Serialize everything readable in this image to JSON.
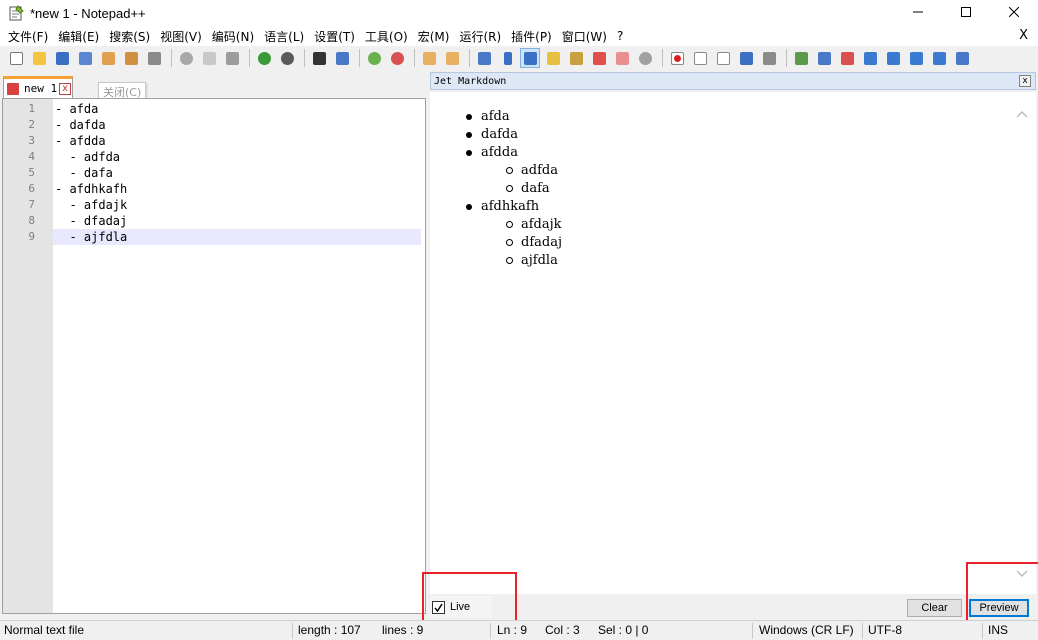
{
  "window": {
    "title": "*new 1 - Notepad++"
  },
  "menu": {
    "items": [
      "文件(F)",
      "编辑(E)",
      "搜索(S)",
      "视图(V)",
      "编码(N)",
      "语言(L)",
      "设置(T)",
      "工具(O)",
      "宏(M)",
      "运行(R)",
      "插件(P)",
      "窗口(W)",
      "?"
    ],
    "close": "X"
  },
  "toolbar": {
    "icons": [
      "new-file-icon",
      "open-file-icon",
      "save-icon",
      "save-all-icon",
      "close-file-icon",
      "close-all-icon",
      "print-icon",
      "cut-icon",
      "copy-icon",
      "paste-icon",
      "undo-icon",
      "redo-icon",
      "find-icon",
      "replace-icon",
      "zoom-in-icon",
      "zoom-out-icon",
      "sync-vertical-icon",
      "sync-horizontal-icon",
      "word-wrap-icon",
      "show-all-chars-icon",
      "indent-guide-icon",
      "lang-define-icon",
      "doc-map-icon",
      "function-list-icon",
      "folder-workspace-icon",
      "monitor-icon",
      "record-macro-icon",
      "stop-record-icon",
      "play-macro-icon",
      "run-macro-multiple-icon",
      "save-macro-icon",
      "jet-md-preview-icon",
      "jet-md-table-icon",
      "jet-md-html-icon",
      "jet-md-top-icon",
      "jet-md-up-icon",
      "jet-md-down-icon",
      "jet-md-bottom-icon",
      "jet-md-config-icon"
    ]
  },
  "tab": {
    "label": "new 1",
    "close": "x",
    "tooltip": "关闭(C)"
  },
  "editor": {
    "line_numbers": [
      "1",
      "2",
      "3",
      "4",
      "5",
      "6",
      "7",
      "8",
      "9"
    ],
    "lines": [
      "- afda",
      "- dafda",
      "- afdda",
      "  - adfda",
      "  - dafa",
      "- afdhkafh",
      "  - afdajk",
      "  - dfadaj",
      "  - ajfdla"
    ],
    "current_line": 9
  },
  "panel": {
    "title": "Jet Markdown",
    "close": "x",
    "list": [
      {
        "text": "afda",
        "children": []
      },
      {
        "text": "dafda",
        "children": []
      },
      {
        "text": "afdda",
        "children": [
          "adfda",
          "dafa"
        ]
      },
      {
        "text": "afdhkafh",
        "children": [
          "afdajk",
          "dfadaj",
          "ajfdla"
        ]
      }
    ],
    "live_label": "Live",
    "live_checked": true,
    "clear_label": "Clear",
    "preview_label": "Preview"
  },
  "status": {
    "file_type": "Normal text file",
    "length": "length : 107",
    "lines": "lines : 9",
    "ln": "Ln : 9",
    "col": "Col : 3",
    "sel": "Sel : 0 | 0",
    "eol": "Windows (CR LF)",
    "encoding": "UTF-8",
    "mode": "INS"
  },
  "colors": {
    "highlight": "#e8222a",
    "current_line": "#e8e8ff",
    "panel_header": "#dde7f5",
    "tab_accent": "#f5a030"
  }
}
